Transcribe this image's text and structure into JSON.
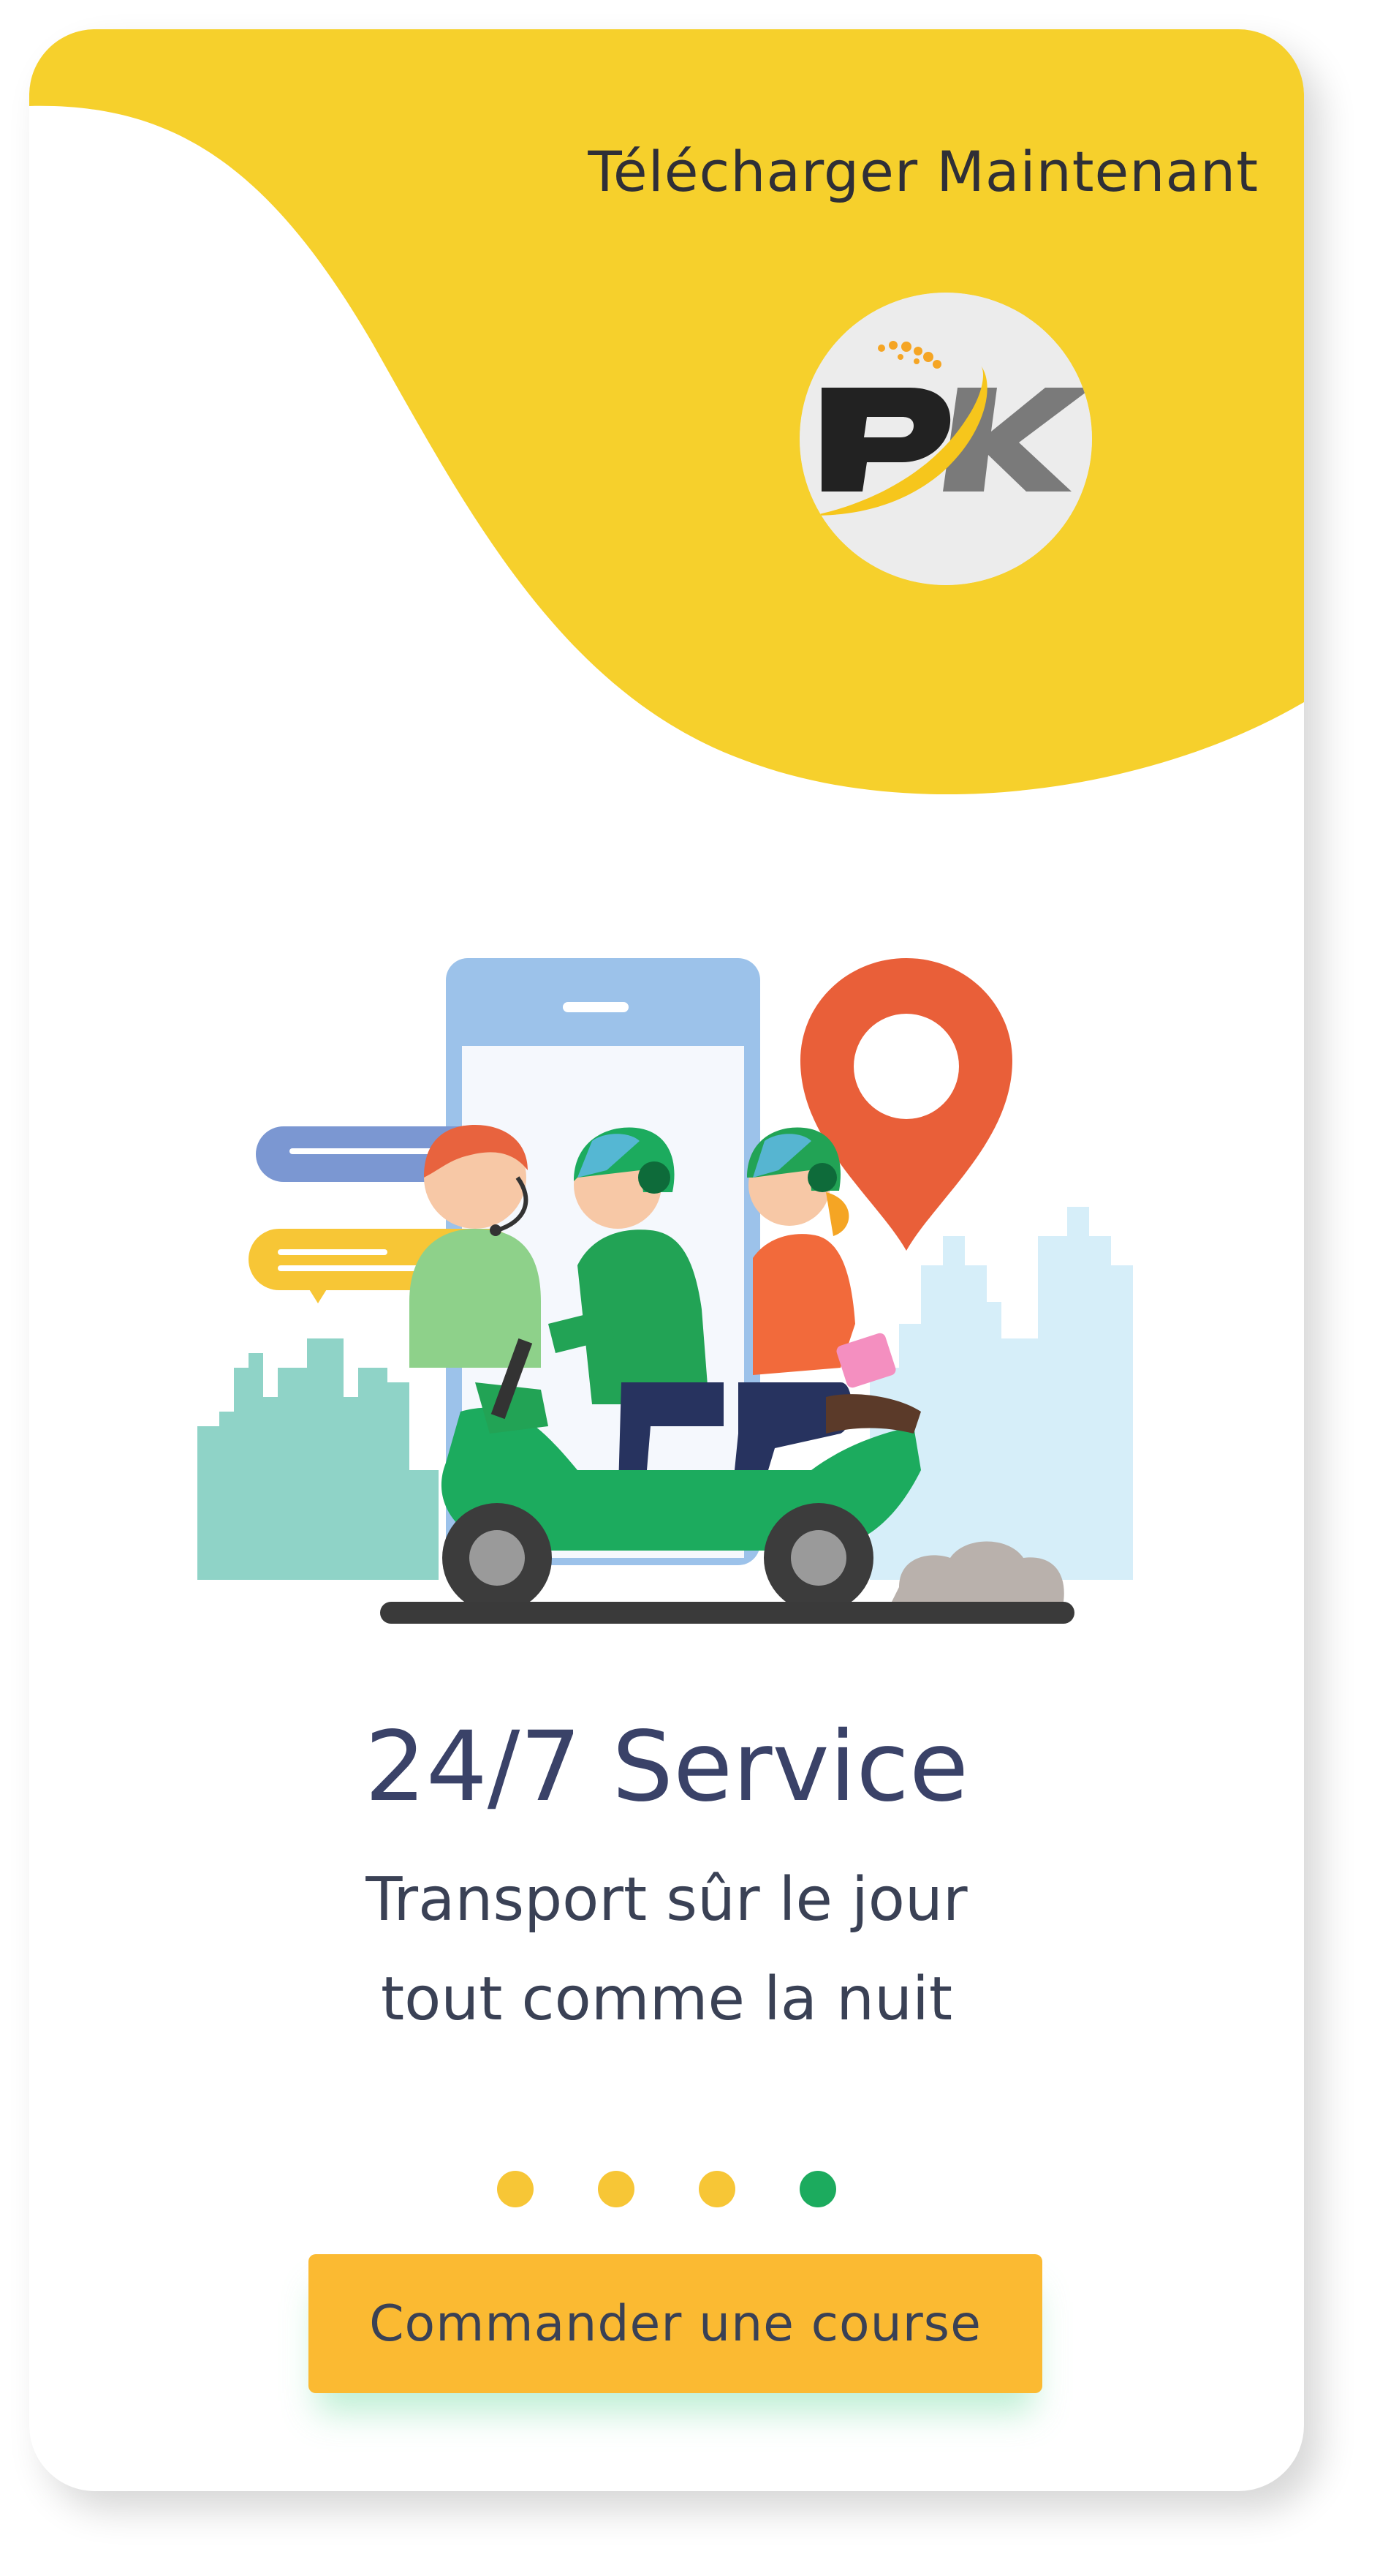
{
  "header": {
    "download_label": "Télécharger Maintenant"
  },
  "logo": {
    "text": "PK",
    "icon": "pk-logo-icon"
  },
  "illustration": {
    "icon": "scooter-delivery-illustration"
  },
  "slide": {
    "title": "24/7 Service",
    "subtitle_line1": "Transport sûr le jour",
    "subtitle_line2": "tout comme la nuit"
  },
  "pagination": {
    "total": 4,
    "active_index": 3
  },
  "cta": {
    "label": "Commander une course"
  },
  "colors": {
    "brand_yellow": "#f6d02c",
    "button_yellow": "#fbba32",
    "dot_inactive": "#f7c636",
    "dot_active": "#1cab5e",
    "text_dark": "#3a4268"
  }
}
